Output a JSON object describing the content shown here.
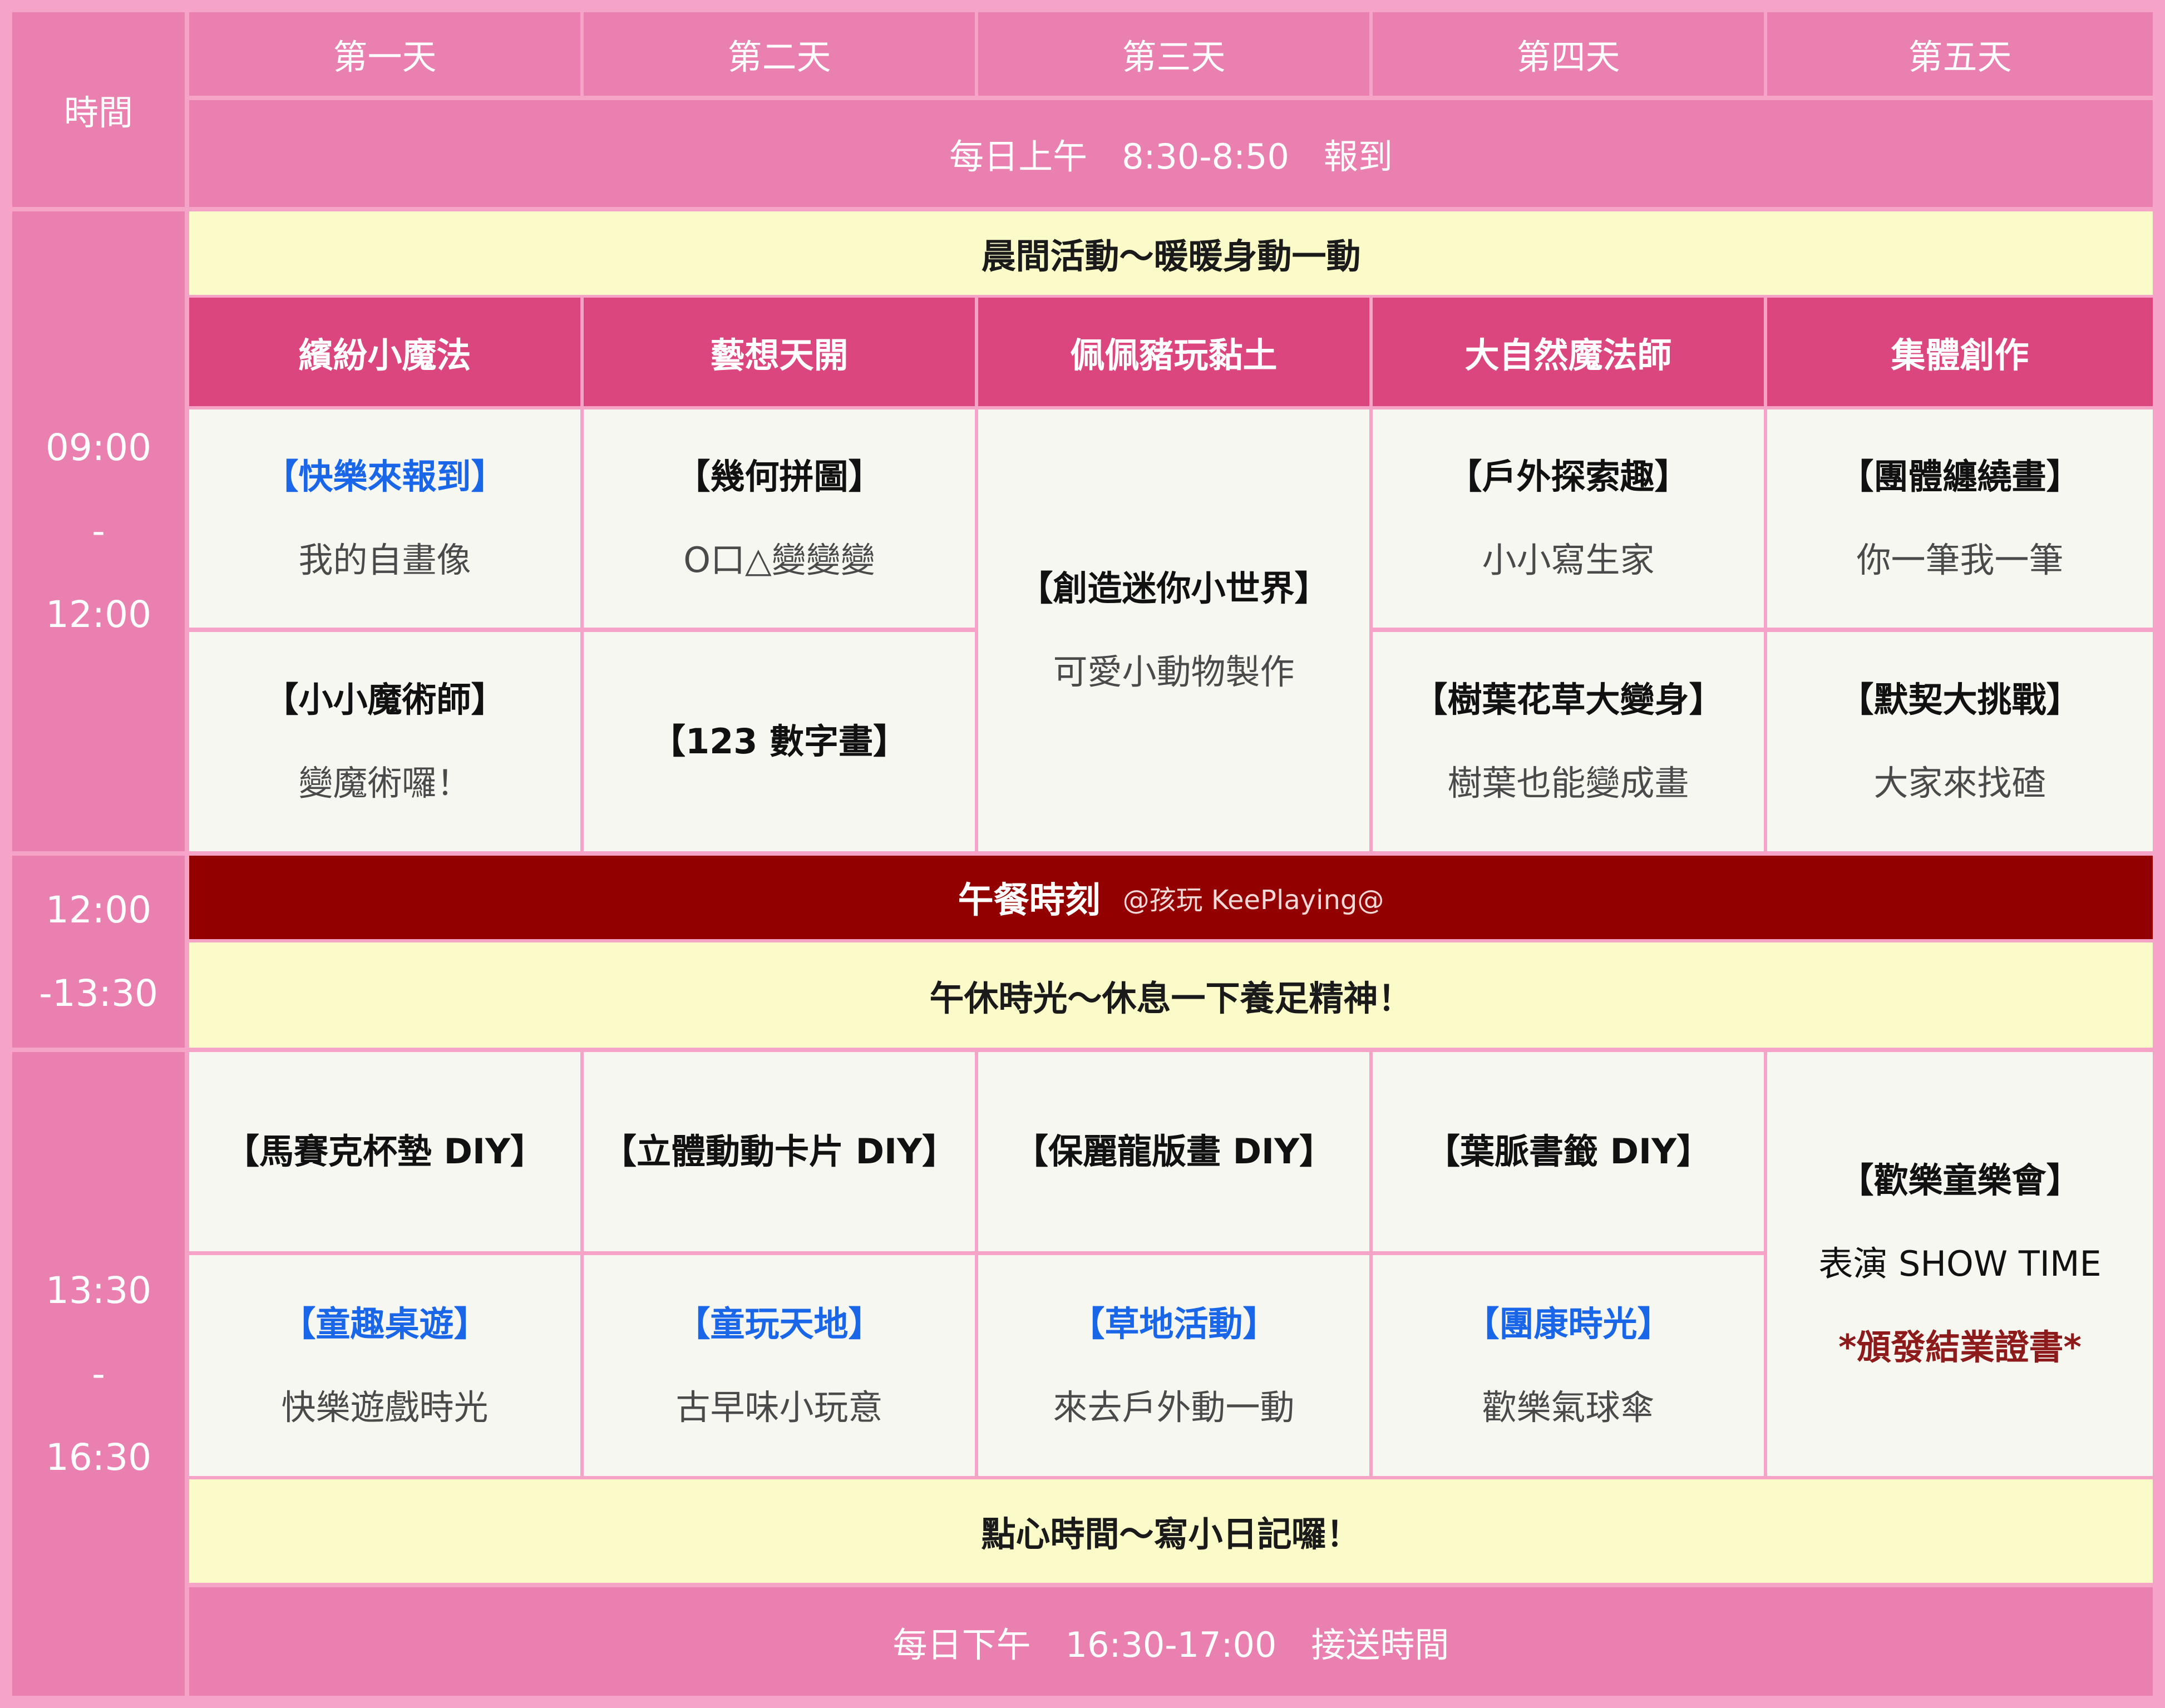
{
  "header": {
    "time_label": "時間",
    "days": [
      "第一天",
      "第二天",
      "第三天",
      "第四天",
      "第五天"
    ],
    "checkin": "每日上午　8:30-8:50　報到"
  },
  "morning": {
    "time": [
      "09:00",
      "-",
      "12:00"
    ],
    "band": "晨間活動～暖暖身動一動",
    "themes": [
      "繽紛小魔法",
      "藝想天開",
      "佩佩豬玩黏土",
      "大自然魔法師",
      "集體創作"
    ],
    "day1": [
      {
        "title": "【快樂來報到】",
        "sub": "我的自畫像"
      },
      {
        "title": "【小小魔術師】",
        "sub": "變魔術囉！"
      }
    ],
    "day2": [
      {
        "title": "【幾何拼圖】",
        "sub": "O口△變變變"
      },
      {
        "title": "【123 數字畫】"
      }
    ],
    "day3": {
      "title": "【創造迷你小世界】",
      "sub": "可愛小動物製作"
    },
    "day4": [
      {
        "title": "【戶外探索趣】",
        "sub": "小小寫生家"
      },
      {
        "title": "【樹葉花草大變身】",
        "sub": "樹葉也能變成畫"
      }
    ],
    "day5": [
      {
        "title": "【團體纏繞畫】",
        "sub": "你一筆我一筆"
      },
      {
        "title": "【默契大挑戰】",
        "sub": "大家來找碴"
      }
    ]
  },
  "lunch": {
    "time": [
      "12:00",
      "-13:30"
    ],
    "title": "午餐時刻",
    "watermark": "@孩玩 KeePlaying@",
    "rest": "午休時光～休息一下養足精神！"
  },
  "afternoon": {
    "time": [
      "13:30",
      "-",
      "16:30"
    ],
    "diy": [
      "【馬賽克杯墊 DIY】",
      "【立體動動卡片 DIY】",
      "【保麗龍版畫 DIY】",
      "【葉脈書籤 DIY】"
    ],
    "games": [
      {
        "title": "【童趣桌遊】",
        "sub": "快樂遊戲時光"
      },
      {
        "title": "【童玩天地】",
        "sub": "古早味小玩意"
      },
      {
        "title": "【草地活動】",
        "sub": "來去戶外動一動"
      },
      {
        "title": "【團康時光】",
        "sub": "歡樂氣球傘"
      }
    ],
    "day5": {
      "title": "【歡樂童樂會】",
      "sub": "表演 SHOW TIME",
      "note": "*頒發結業證書*"
    },
    "snack": "點心時間～寫小日記囉！",
    "pickup": "每日下午　16:30-17:00　接送時間"
  },
  "colors": {
    "pink": "#e980af",
    "light_pink_border": "#f5a3c7",
    "yellow": "#fbfbc9",
    "magenta": "#da467d",
    "dark_red": "#930000",
    "blue_title": "#1a66e8",
    "red_note": "#8e1b1b"
  }
}
